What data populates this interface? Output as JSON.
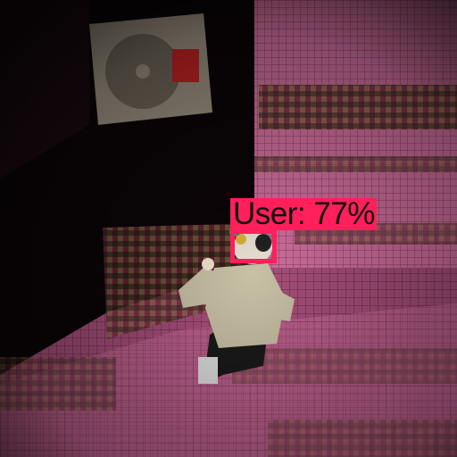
{
  "detection": {
    "label": "User: 77%",
    "class": "User",
    "confidence": 77,
    "color": "#ff1f5a"
  },
  "scene": {
    "wall_color": "#d77aa4",
    "floor_color": "#b8557f"
  }
}
